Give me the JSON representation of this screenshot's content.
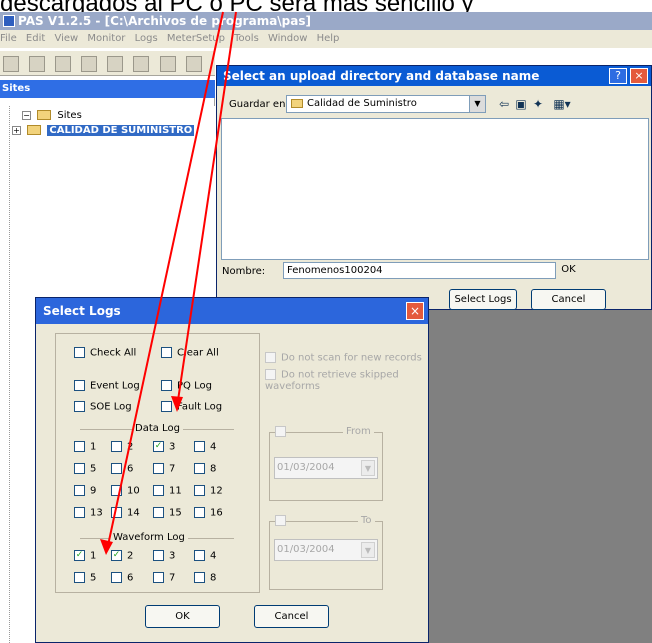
{
  "top_caption": "descargados al PC o PC será más sencillo y",
  "app": {
    "title": "PAS V1.2.5 - [C:\\Archivos de programa\\pas]",
    "menus": [
      "File",
      "Edit",
      "View",
      "Monitor",
      "Logs",
      "MeterSetup",
      "Tools",
      "Window",
      "Help"
    ]
  },
  "left_panel": {
    "header": "Sites",
    "tree": {
      "root": "Sites",
      "child": "CALIDAD DE SUMINISTRO"
    }
  },
  "save_dialog": {
    "title": "Select an upload directory and database name",
    "save_in_label": "Guardar en:",
    "folder": "Calidad de Suministro",
    "name_label": "Nombre:",
    "name_value": "Fenomenos100204",
    "ok": "OK",
    "select_logs": "Select Logs",
    "cancel": "Cancel"
  },
  "select_logs": {
    "title": "Select Logs",
    "check_all": "Check All",
    "clear_all": "Clear All",
    "event_log": "Event Log",
    "pq_log": "PQ Log",
    "soe_log": "SOE Log",
    "fault_log": "Fault Log",
    "data_log_label": "Data Log",
    "data_items": [
      "1",
      "2",
      "3",
      "4",
      "5",
      "6",
      "7",
      "8",
      "9",
      "10",
      "11",
      "12",
      "13",
      "14",
      "15",
      "16"
    ],
    "waveform_label": "Waveform Log",
    "waveform_items": [
      "1",
      "2",
      "3",
      "4",
      "5",
      "6",
      "7",
      "8"
    ],
    "options": [
      "Do not scan for new records",
      "Do not retrieve skipped waveforms"
    ],
    "from_label": "From",
    "to_label": "To",
    "from_date": "01/03/2004",
    "to_date": "01/03/2004",
    "ok": "OK",
    "cancel": "Cancel"
  },
  "colors": {
    "title_blue": "#2c66dc",
    "dialog_bg": "#ece9d8",
    "arrow_red": "#ff0000",
    "check_green": "#21a121"
  }
}
